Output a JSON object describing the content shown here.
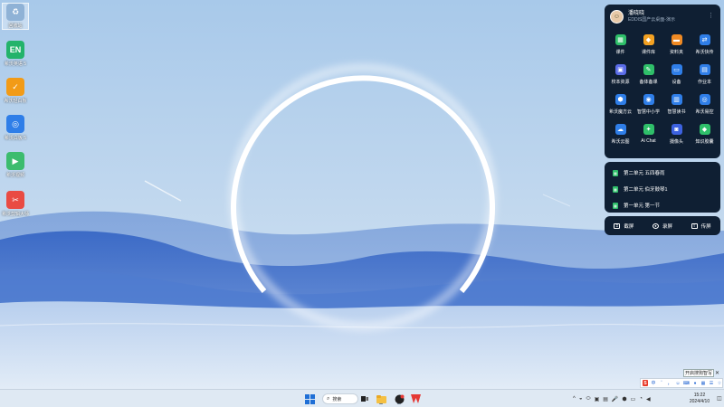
{
  "desktop": {
    "icons": [
      {
        "label": "回收站",
        "glyph": "♻",
        "color": "#8fb2d6"
      },
      {
        "label": "希沃英语 5",
        "glyph": "EN",
        "color": "#23b36b"
      },
      {
        "label": "希沃轻白板",
        "glyph": "✓",
        "color": "#f29b17"
      },
      {
        "label": "希沃白板 5",
        "glyph": "◎",
        "color": "#2f7ee8"
      },
      {
        "label": "希沃视频",
        "glyph": "▶",
        "color": "#3cbc6e"
      },
      {
        "label": "希沃剪辑大师",
        "glyph": "✂",
        "color": "#e94b43"
      }
    ]
  },
  "panel": {
    "user_name": "潘晓晓",
    "user_sub": "EDDIS国产云桌面-演示",
    "more_icon": "more-vertical-icon",
    "apps": [
      {
        "label": "课件",
        "glyph": "▦",
        "color": "#2fbf6a"
      },
      {
        "label": "课件库",
        "glyph": "◆",
        "color": "#f3a122"
      },
      {
        "label": "资料夹",
        "glyph": "▬",
        "color": "#f08a24"
      },
      {
        "label": "希沃快传",
        "glyph": "⇄",
        "color": "#2f7ee8"
      },
      {
        "label": "校本资源",
        "glyph": "▣",
        "color": "#5b6de8"
      },
      {
        "label": "备体备课",
        "glyph": "✎",
        "color": "#2fbf6a"
      },
      {
        "label": "设备",
        "glyph": "▭",
        "color": "#2f7ee8"
      },
      {
        "label": "作业本",
        "glyph": "▤",
        "color": "#2f7ee8"
      },
      {
        "label": "希沃魔方云",
        "glyph": "⬢",
        "color": "#2f7ee8"
      },
      {
        "label": "智慧中小学",
        "glyph": "◉",
        "color": "#2f7ee8"
      },
      {
        "label": "智慧读书",
        "glyph": "▥",
        "color": "#2f7ee8"
      },
      {
        "label": "希沃易控",
        "glyph": "◎",
        "color": "#2f7ee8"
      },
      {
        "label": "希沃云图",
        "glyph": "☁",
        "color": "#2f7ee8"
      },
      {
        "label": "Ai Chat",
        "glyph": "✦",
        "color": "#2fbf6a"
      },
      {
        "label": "摄像头",
        "glyph": "◙",
        "color": "#3d62e0"
      },
      {
        "label": "知识胶囊",
        "glyph": "◆",
        "color": "#2fbf6a"
      }
    ],
    "files": [
      {
        "label": "第二单元 五四春雨"
      },
      {
        "label": "第二单元 伯牙鼓琴1"
      },
      {
        "label": "第一单元 第一节"
      }
    ],
    "actions": [
      {
        "label": "截屏",
        "icon": "screenshot-icon"
      },
      {
        "label": "录屏",
        "icon": "record-icon"
      },
      {
        "label": "传屏",
        "icon": "cast-icon"
      }
    ]
  },
  "ime": {
    "tip": "开启搜狗智写",
    "close": "✕",
    "logo": "S",
    "items": [
      "中",
      "ˇ",
      "，",
      "☺",
      "⌨",
      "♦",
      "▦",
      "☰",
      "☆"
    ]
  },
  "taskbar": {
    "search_label": "搜索",
    "tray_icons": [
      "^",
      "◒",
      "⬭",
      "▣",
      "▤",
      "🎤",
      "⬢",
      "▭",
      "◔",
      "◀"
    ],
    "time": "15:22",
    "date": "2024/4/10"
  }
}
